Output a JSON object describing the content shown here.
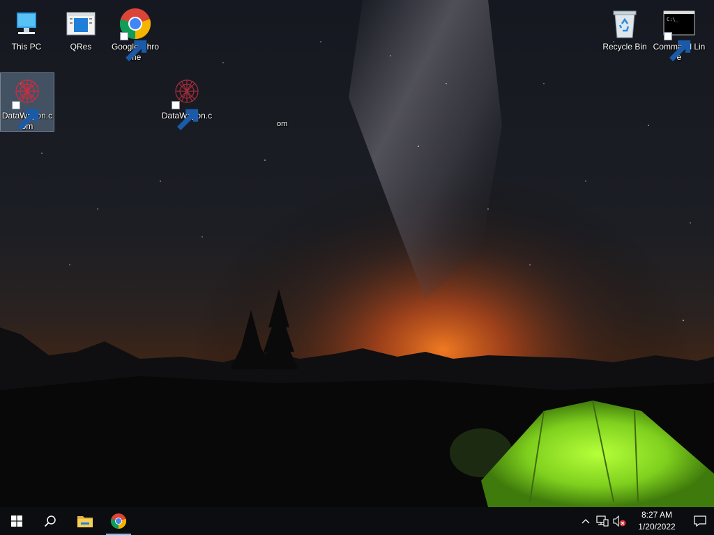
{
  "desktop": {
    "icons": [
      {
        "label": "This PC",
        "icon": "this-pc-icon"
      },
      {
        "label": "QRes",
        "icon": "qres-icon"
      },
      {
        "label": "Google Chrome",
        "icon": "chrome-icon"
      },
      {
        "label": "Recycle Bin",
        "icon": "recycle-bin-icon"
      },
      {
        "label": "Command Line",
        "icon": "command-line-icon"
      },
      {
        "label": "DataWagon.com",
        "icon": "datawagon-icon"
      },
      {
        "label": "DataWagon.c",
        "icon": "datawagon-icon"
      }
    ],
    "stray_text": "om"
  },
  "taskbar": {
    "start": "start-icon",
    "search": "search-icon",
    "pinned": [
      {
        "name": "File Explorer",
        "icon": "file-explorer-icon",
        "active": false
      },
      {
        "name": "Google Chrome",
        "icon": "chrome-icon",
        "active": true
      }
    ],
    "tray": {
      "icons": [
        "chevron-up-icon",
        "network-icon",
        "volume-muted-icon"
      ],
      "time": "8:27 AM",
      "date": "1/20/2022",
      "notification": "action-center-icon"
    }
  },
  "colors": {
    "taskbar_bg": "#0c0d10",
    "active_indicator": "#76b9ed",
    "tent": "#8fe02a",
    "horizon_glow": "#e0641c"
  }
}
